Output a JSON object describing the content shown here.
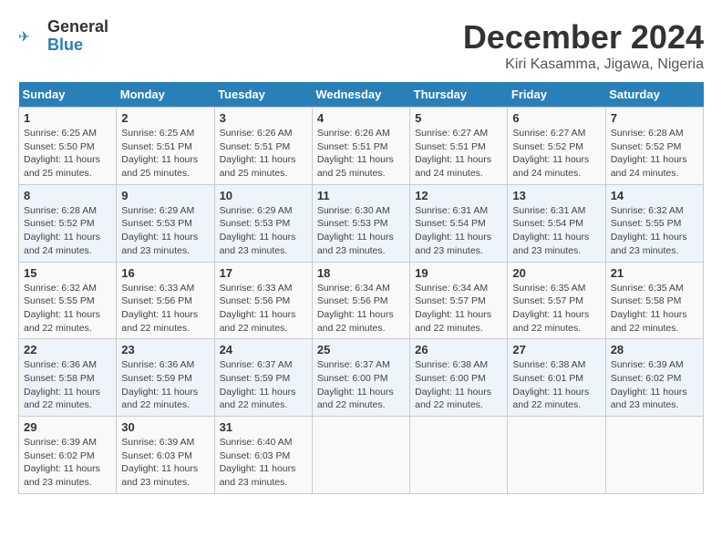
{
  "header": {
    "logo": {
      "general": "General",
      "blue": "Blue"
    },
    "title": "December 2024",
    "subtitle": "Kiri Kasamma, Jigawa, Nigeria"
  },
  "calendar": {
    "columns": [
      "Sunday",
      "Monday",
      "Tuesday",
      "Wednesday",
      "Thursday",
      "Friday",
      "Saturday"
    ],
    "weeks": [
      [
        {
          "day": "1",
          "detail": "Sunrise: 6:25 AM\nSunset: 5:50 PM\nDaylight: 11 hours and 25 minutes."
        },
        {
          "day": "2",
          "detail": "Sunrise: 6:25 AM\nSunset: 5:51 PM\nDaylight: 11 hours and 25 minutes."
        },
        {
          "day": "3",
          "detail": "Sunrise: 6:26 AM\nSunset: 5:51 PM\nDaylight: 11 hours and 25 minutes."
        },
        {
          "day": "4",
          "detail": "Sunrise: 6:26 AM\nSunset: 5:51 PM\nDaylight: 11 hours and 25 minutes."
        },
        {
          "day": "5",
          "detail": "Sunrise: 6:27 AM\nSunset: 5:51 PM\nDaylight: 11 hours and 24 minutes."
        },
        {
          "day": "6",
          "detail": "Sunrise: 6:27 AM\nSunset: 5:52 PM\nDaylight: 11 hours and 24 minutes."
        },
        {
          "day": "7",
          "detail": "Sunrise: 6:28 AM\nSunset: 5:52 PM\nDaylight: 11 hours and 24 minutes."
        }
      ],
      [
        {
          "day": "8",
          "detail": "Sunrise: 6:28 AM\nSunset: 5:52 PM\nDaylight: 11 hours and 24 minutes."
        },
        {
          "day": "9",
          "detail": "Sunrise: 6:29 AM\nSunset: 5:53 PM\nDaylight: 11 hours and 23 minutes."
        },
        {
          "day": "10",
          "detail": "Sunrise: 6:29 AM\nSunset: 5:53 PM\nDaylight: 11 hours and 23 minutes."
        },
        {
          "day": "11",
          "detail": "Sunrise: 6:30 AM\nSunset: 5:53 PM\nDaylight: 11 hours and 23 minutes."
        },
        {
          "day": "12",
          "detail": "Sunrise: 6:31 AM\nSunset: 5:54 PM\nDaylight: 11 hours and 23 minutes."
        },
        {
          "day": "13",
          "detail": "Sunrise: 6:31 AM\nSunset: 5:54 PM\nDaylight: 11 hours and 23 minutes."
        },
        {
          "day": "14",
          "detail": "Sunrise: 6:32 AM\nSunset: 5:55 PM\nDaylight: 11 hours and 23 minutes."
        }
      ],
      [
        {
          "day": "15",
          "detail": "Sunrise: 6:32 AM\nSunset: 5:55 PM\nDaylight: 11 hours and 22 minutes."
        },
        {
          "day": "16",
          "detail": "Sunrise: 6:33 AM\nSunset: 5:56 PM\nDaylight: 11 hours and 22 minutes."
        },
        {
          "day": "17",
          "detail": "Sunrise: 6:33 AM\nSunset: 5:56 PM\nDaylight: 11 hours and 22 minutes."
        },
        {
          "day": "18",
          "detail": "Sunrise: 6:34 AM\nSunset: 5:56 PM\nDaylight: 11 hours and 22 minutes."
        },
        {
          "day": "19",
          "detail": "Sunrise: 6:34 AM\nSunset: 5:57 PM\nDaylight: 11 hours and 22 minutes."
        },
        {
          "day": "20",
          "detail": "Sunrise: 6:35 AM\nSunset: 5:57 PM\nDaylight: 11 hours and 22 minutes."
        },
        {
          "day": "21",
          "detail": "Sunrise: 6:35 AM\nSunset: 5:58 PM\nDaylight: 11 hours and 22 minutes."
        }
      ],
      [
        {
          "day": "22",
          "detail": "Sunrise: 6:36 AM\nSunset: 5:58 PM\nDaylight: 11 hours and 22 minutes."
        },
        {
          "day": "23",
          "detail": "Sunrise: 6:36 AM\nSunset: 5:59 PM\nDaylight: 11 hours and 22 minutes."
        },
        {
          "day": "24",
          "detail": "Sunrise: 6:37 AM\nSunset: 5:59 PM\nDaylight: 11 hours and 22 minutes."
        },
        {
          "day": "25",
          "detail": "Sunrise: 6:37 AM\nSunset: 6:00 PM\nDaylight: 11 hours and 22 minutes."
        },
        {
          "day": "26",
          "detail": "Sunrise: 6:38 AM\nSunset: 6:00 PM\nDaylight: 11 hours and 22 minutes."
        },
        {
          "day": "27",
          "detail": "Sunrise: 6:38 AM\nSunset: 6:01 PM\nDaylight: 11 hours and 22 minutes."
        },
        {
          "day": "28",
          "detail": "Sunrise: 6:39 AM\nSunset: 6:02 PM\nDaylight: 11 hours and 23 minutes."
        }
      ],
      [
        {
          "day": "29",
          "detail": "Sunrise: 6:39 AM\nSunset: 6:02 PM\nDaylight: 11 hours and 23 minutes."
        },
        {
          "day": "30",
          "detail": "Sunrise: 6:39 AM\nSunset: 6:03 PM\nDaylight: 11 hours and 23 minutes."
        },
        {
          "day": "31",
          "detail": "Sunrise: 6:40 AM\nSunset: 6:03 PM\nDaylight: 11 hours and 23 minutes."
        },
        {
          "day": "",
          "detail": ""
        },
        {
          "day": "",
          "detail": ""
        },
        {
          "day": "",
          "detail": ""
        },
        {
          "day": "",
          "detail": ""
        }
      ]
    ]
  }
}
